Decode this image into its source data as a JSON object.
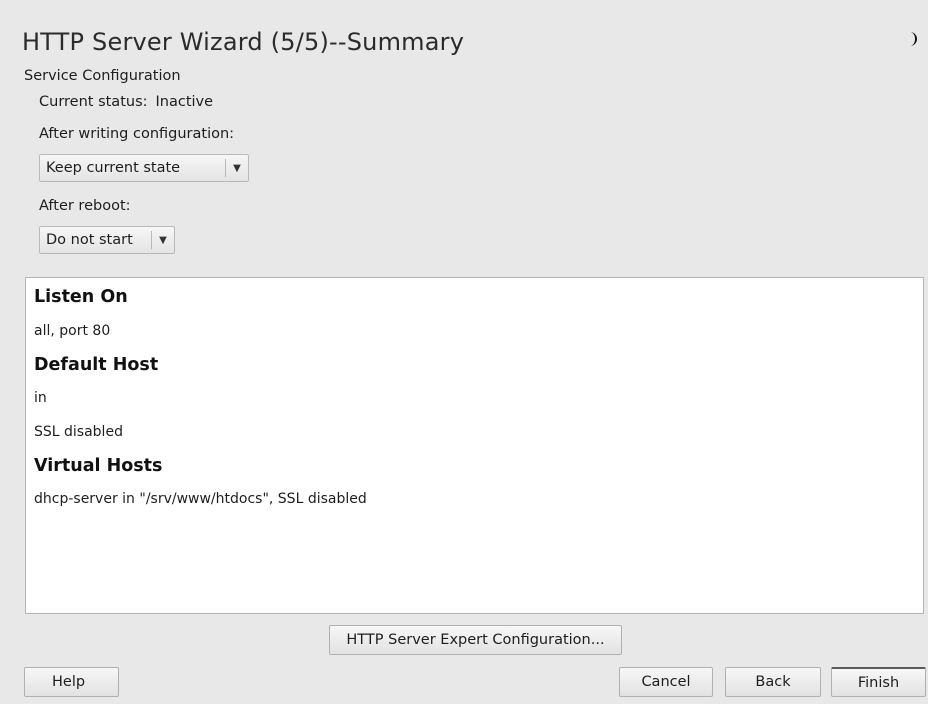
{
  "header": {
    "title": "HTTP Server Wizard (5/5)--Summary",
    "status_icon": "moon-icon"
  },
  "service": {
    "section_label": "Service Configuration",
    "current_status_label": "Current status:",
    "current_status_value": "Inactive",
    "after_writing_label": "After writing configuration:",
    "after_writing_value": "Keep current state",
    "after_reboot_label": "After reboot:",
    "after_reboot_value": "Do not start"
  },
  "summary": {
    "listen_heading": "Listen On",
    "listen_value": "all, port 80",
    "default_host_heading": "Default Host",
    "default_host_line1": "in",
    "default_host_line2": "SSL disabled",
    "virtual_hosts_heading": "Virtual Hosts",
    "virtual_hosts_value": "dhcp-server in \"/srv/www/htdocs\", SSL disabled"
  },
  "buttons": {
    "expert": "HTTP Server Expert Configuration...",
    "help": "Help",
    "cancel": "Cancel",
    "back": "Back",
    "finish": "Finish"
  },
  "colors": {
    "background": "#e8e8e8",
    "panel": "#ffffff"
  }
}
